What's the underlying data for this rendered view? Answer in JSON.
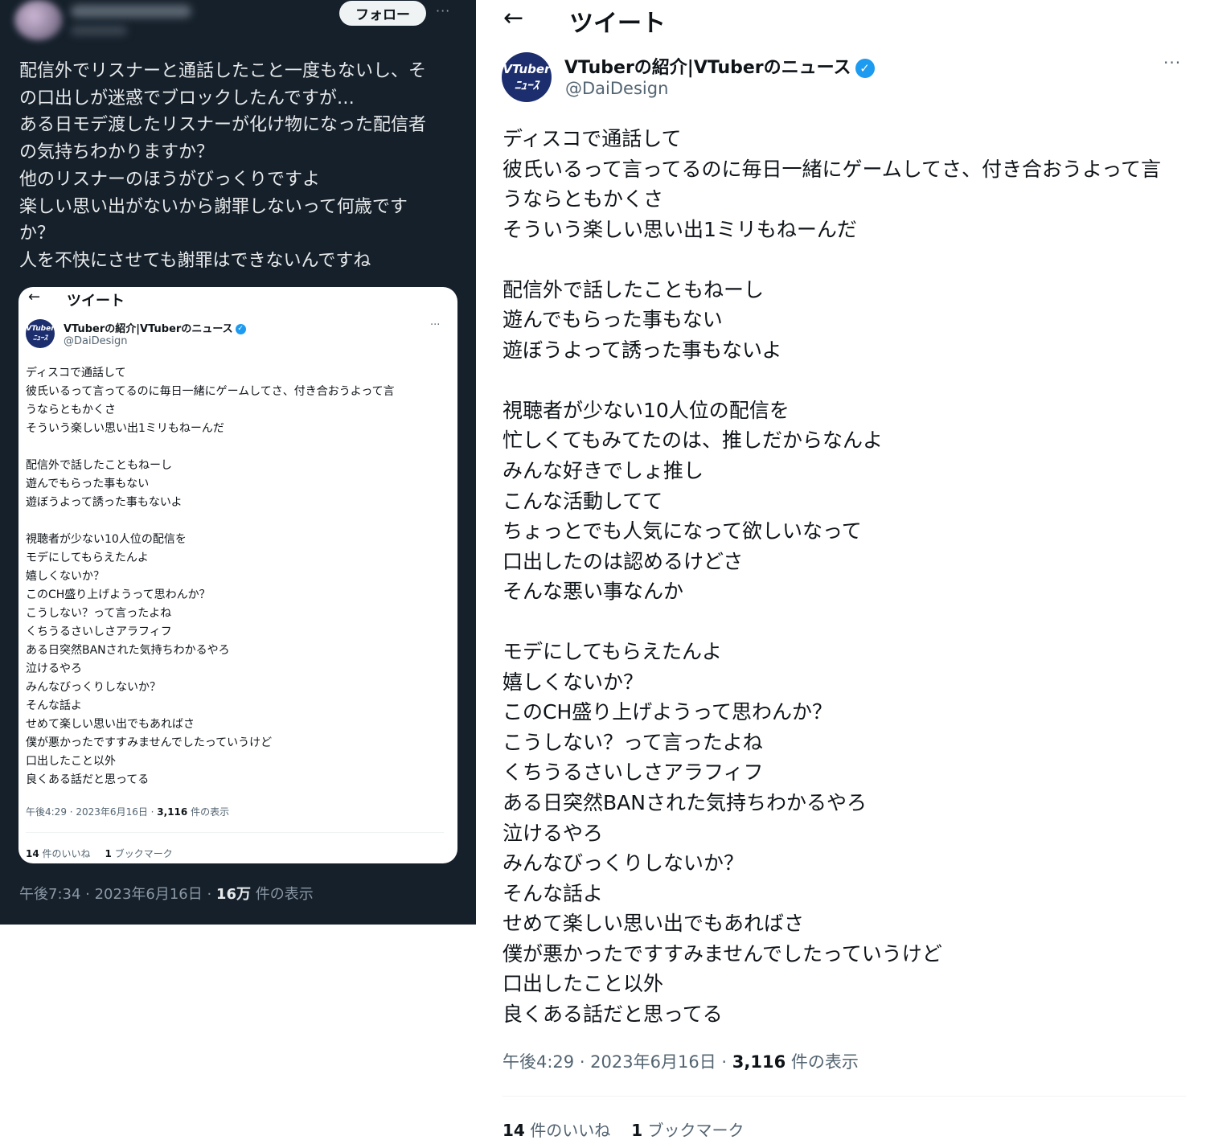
{
  "left_tweet": {
    "follow_label": "フォロー",
    "more_label": "···",
    "text_lines": [
      "配信外でリスナーと通話したこと一度もないし、そ",
      "の口出しが迷惑でブロックしたんですが…",
      "ある日モデ渡したリスナーが化け物になった配信者",
      "の気持ちわかりますか？",
      "他のリスナーのほうがびっくりですよ",
      "楽しい思い出がないから謝罪しないって何歳です",
      "か？",
      "人を不快にさせても謝罪はできないんですね"
    ],
    "meta": {
      "time": "午後7:34 · 2023年6月16日 · ",
      "views_count": "16万",
      "views_label": " 件の表示"
    }
  },
  "quoted": {
    "header_title": "ツイート",
    "back_icon": "←",
    "avatar_text_1": "VTuber",
    "avatar_text_2": "ﾆｭｰｽ",
    "display_name": "VTuberの紹介|VTuberのニュース",
    "verified_icon": "✓",
    "handle": "@DaiDesign",
    "more_label": "···",
    "embed_body_lines": [
      "ディスコで通話して",
      "彼氏いるって言ってるのに毎日一緒にゲームしてさ、付き合おうよって言",
      "うならともかくさ",
      "そういう楽しい思い出1ミリもねーんだ",
      "",
      "配信外で話したこともねーし",
      "遊んでもらった事もない",
      "遊ぼうよって誘った事もないよ",
      "",
      "視聴者が少ない10人位の配信を",
      "モデにしてもらえたんよ",
      "嬉しくないか？",
      "このCH盛り上げようって思わんか？",
      "こうしない？って言ったよね",
      "くちうるさいしさアラフィフ",
      "ある日突然BANされた気持ちわかるやろ",
      "泣けるやろ",
      "みんなびっくりしないか？",
      "そんな話よ",
      "せめて楽しい思い出でもあればさ",
      "僕が悪かったですすみませんでしたっていうけど",
      "口出したこと以外",
      "良くある話だと思ってる"
    ],
    "body_lines": [
      "ディスコで通話して",
      "彼氏いるって言ってるのに毎日一緒にゲームしてさ、付き合おうよって言",
      "うならともかくさ",
      "そういう楽しい思い出1ミリもねーんだ",
      "",
      "配信外で話したこともねーし",
      "遊んでもらった事もない",
      "遊ぼうよって誘った事もないよ",
      "",
      "視聴者が少ない10人位の配信を",
      "忙しくてもみてたのは、推しだからなんよ",
      "みんな好きでしょ推し",
      "こんな活動してて",
      "ちょっとでも人気になって欲しいなって",
      "口出したのは認めるけどさ",
      "そんな悪い事なんか",
      "",
      "モデにしてもらえたんよ",
      "嬉しくないか？",
      "このCH盛り上げようって思わんか？",
      "こうしない？って言ったよね",
      "くちうるさいしさアラフィフ",
      "ある日突然BANされた気持ちわかるやろ",
      "泣けるやろ",
      "みんなびっくりしないか？",
      "そんな話よ",
      "せめて楽しい思い出でもあればさ",
      "僕が悪かったですすみませんでしたっていうけど",
      "口出したこと以外",
      "良くある話だと思ってる"
    ],
    "meta": {
      "time": "午後4:29 · 2023年6月16日 · ",
      "views_count": "3,116",
      "views_label": " 件の表示"
    },
    "likes_count": "14",
    "likes_label": " 件のいいね",
    "bookmarks_count": "1",
    "bookmarks_label": " ブックマーク"
  },
  "colors": {
    "dark_bg": "#15202b",
    "verified_blue": "#1d9bf0",
    "secondary_text": "#536471"
  }
}
